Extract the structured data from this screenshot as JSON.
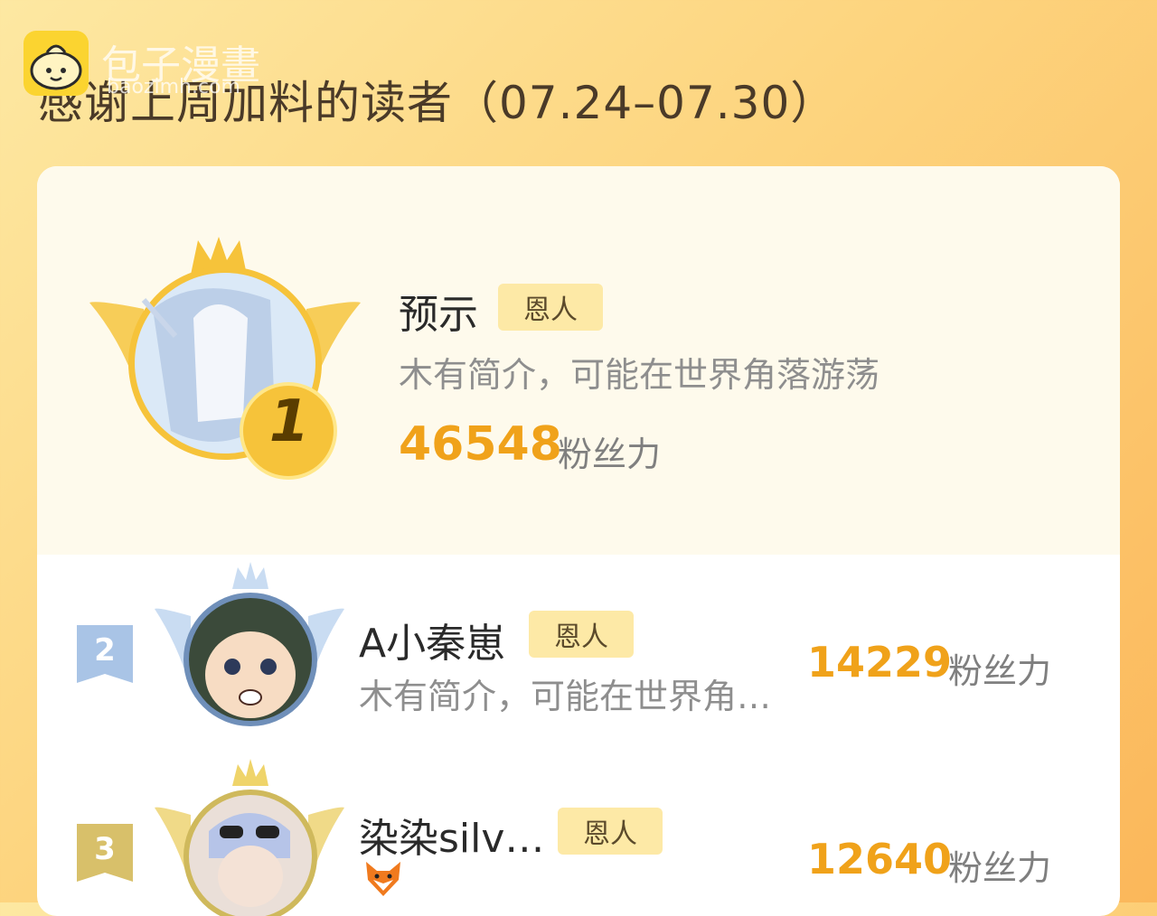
{
  "header": {
    "title": "感谢上周加料的读者（07.24–07.30）"
  },
  "watermark": {
    "text": "包子漫畫",
    "url": "baozimh.com"
  },
  "top_reader": {
    "rank": "1",
    "name": "预示",
    "badge": "恩人",
    "bio": "木有简介，可能在世界角落游荡",
    "score": "46548",
    "score_label": "粉丝力"
  },
  "readers": [
    {
      "rank": "2",
      "name": "A小秦崽",
      "badge": "恩人",
      "bio": "木有简介，可能在世界角…",
      "score": "14229",
      "score_label": "粉丝力"
    },
    {
      "rank": "3",
      "name": "染染silv…",
      "badge": "恩人",
      "bio_icon": "fox-icon",
      "score": "12640",
      "score_label": "粉丝力"
    }
  ],
  "colors": {
    "accent": "#f0a21a",
    "gold": "#f6c33a",
    "silver": "#a9c4e6",
    "bronze": "#d8c06a",
    "badge_bg": "#fde9a6"
  }
}
